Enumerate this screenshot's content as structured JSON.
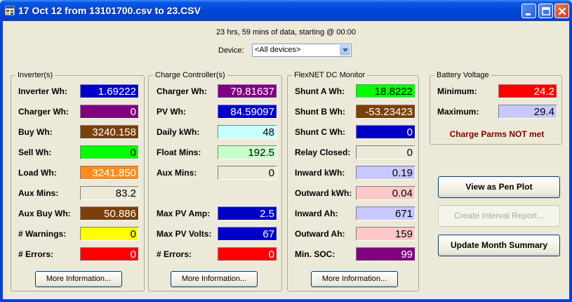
{
  "window": {
    "title": "17 Oct 12 from 13101700.csv to 23.CSV"
  },
  "info": "23 hrs, 59 mins of data, starting @ 00:00",
  "device": {
    "label": "Device:",
    "value": "<All devices>"
  },
  "inverter": {
    "title": "Inverter(s)",
    "rows": [
      {
        "label": "Inverter Wh:",
        "value": "1.69222",
        "bg": "#0000c8",
        "fg": "#ffffff"
      },
      {
        "label": "Charger Wh:",
        "value": "0",
        "bg": "#800080",
        "fg": "#ffffff"
      },
      {
        "label": "Buy Wh:",
        "value": "3240.158",
        "bg": "#7b3f0a",
        "fg": "#ffffff"
      },
      {
        "label": "Sell Wh:",
        "value": "0",
        "bg": "#00ff00",
        "fg": "#000000"
      },
      {
        "label": "Load Wh:",
        "value": "3241.850",
        "bg": "#ff8c1a",
        "fg": "#ffffff"
      },
      {
        "label": "Aux Mins:",
        "value": "83.2",
        "bg": "#ece9d8",
        "fg": "#000000"
      },
      {
        "label": "Aux Buy Wh:",
        "value": "50.886",
        "bg": "#7b3f0a",
        "fg": "#ffffff"
      },
      {
        "label": "# Warnings:",
        "value": "0",
        "bg": "#ffff00",
        "fg": "#000000"
      },
      {
        "label": "# Errors:",
        "value": "0",
        "bg": "#ff0000",
        "fg": "#ffffff"
      }
    ],
    "button": "More Information..."
  },
  "charge": {
    "title": "Charge Controller(s)",
    "rows": [
      {
        "label": "Charger Wh:",
        "value": "79.81637",
        "bg": "#800080",
        "fg": "#ffffff"
      },
      {
        "label": "PV Wh:",
        "value": "84.59097",
        "bg": "#0000c8",
        "fg": "#ffffff"
      },
      {
        "label": "Daily kWh:",
        "value": "48",
        "bg": "#c8ffff",
        "fg": "#000000"
      },
      {
        "label": "Float Mins:",
        "value": "192.5",
        "bg": "#c8ffc8",
        "fg": "#000000"
      },
      {
        "label": "Aux Mins:",
        "value": "0",
        "bg": "#ece9d8",
        "fg": "#000000"
      },
      {
        "label": "Max PV Amp:",
        "value": "2.5",
        "bg": "#0000c8",
        "fg": "#ffffff"
      },
      {
        "label": "Max PV Volts:",
        "value": "67",
        "bg": "#0000c8",
        "fg": "#ffffff"
      },
      {
        "label": "# Errors:",
        "value": "0",
        "bg": "#ff0000",
        "fg": "#ffffff"
      }
    ],
    "button": "More Information..."
  },
  "flexnet": {
    "title": "FlexNET DC Monitor",
    "rows": [
      {
        "label": "Shunt A Wh:",
        "value": "18.8222",
        "bg": "#00ff00",
        "fg": "#000000"
      },
      {
        "label": "Shunt B Wh:",
        "value": "-53.23423",
        "bg": "#7b3f0a",
        "fg": "#ffffff"
      },
      {
        "label": "Shunt C Wh:",
        "value": "0",
        "bg": "#0000c8",
        "fg": "#ffffff"
      },
      {
        "label": "Relay Closed:",
        "value": "0",
        "bg": "#ece9d8",
        "fg": "#000000"
      },
      {
        "label": "Inward kWh:",
        "value": "0.19",
        "bg": "#c8c8ff",
        "fg": "#000000"
      },
      {
        "label": "Outward kWh:",
        "value": "0.04",
        "bg": "#ffc8c8",
        "fg": "#000000"
      },
      {
        "label": "Inward Ah:",
        "value": "671",
        "bg": "#c8c8ff",
        "fg": "#000000"
      },
      {
        "label": "Outward Ah:",
        "value": "159",
        "bg": "#ffc8c8",
        "fg": "#000000"
      },
      {
        "label": "Min. SOC:",
        "value": "99",
        "bg": "#800080",
        "fg": "#ffffff"
      }
    ],
    "button": "More Information..."
  },
  "battery": {
    "title": "Battery Voltage",
    "rows": [
      {
        "label": "Minimum:",
        "value": "24.2",
        "bg": "#ff0000",
        "fg": "#ffffff"
      },
      {
        "label": "Maximum:",
        "value": "29.4",
        "bg": "#c8c8ff",
        "fg": "#000000"
      }
    ],
    "warning": "Charge Parms NOT met"
  },
  "actions": {
    "pen_plot": "View as Pen Plot",
    "interval_report": "Create Interval Report...",
    "month_summary": "Update Month Summary"
  }
}
